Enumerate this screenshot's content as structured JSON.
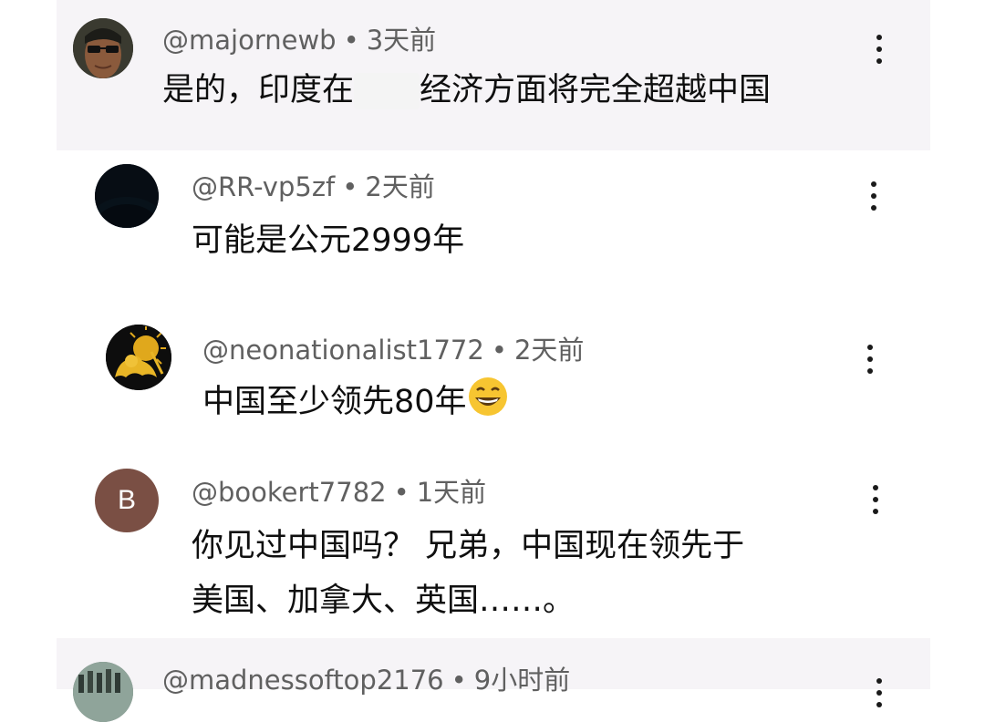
{
  "comments": [
    {
      "handle": "@majornewb",
      "time": "3天前",
      "text_before": "是的，印度在",
      "text_after": "经济方面将完全超越中国",
      "avatar_icon": "person-with-glasses-avatar"
    },
    {
      "handle": "@RR-vp5zf",
      "time": "2天前",
      "text": "可能是公元2999年",
      "avatar_icon": "planet-eclipse-avatar"
    },
    {
      "handle": "@neonationalist1772",
      "time": "2天前",
      "text": "中国至少领先80年",
      "emoji_icon": "grinning-face-emoji",
      "avatar_icon": "lion-sun-emblem-avatar"
    },
    {
      "handle": "@bookert7782",
      "time": "1天前",
      "avatar_letter": "B",
      "avatar_color": "#7a4f44",
      "text_line1": "你见过中国吗？  兄弟，中国现在领先于",
      "text_line2": "美国、加拿大、英国……。"
    },
    {
      "handle": "@madnessoftop2176",
      "time": "9小时前",
      "avatar_icon": "crowd-photo-avatar"
    }
  ],
  "separator": "•",
  "colors": {
    "highlight_bg": "#f6f4f7",
    "meta_text": "#606060",
    "body_text": "#0f0f0f"
  }
}
